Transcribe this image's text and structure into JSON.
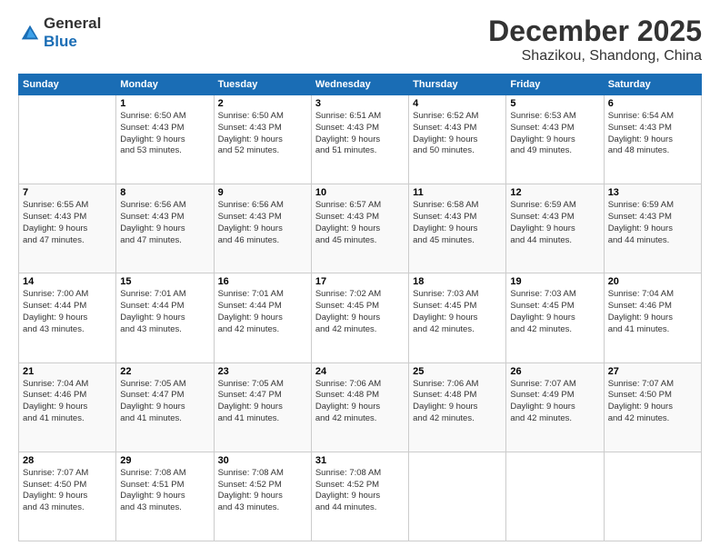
{
  "logo": {
    "line1": "General",
    "line2": "Blue"
  },
  "header": {
    "month": "December 2025",
    "location": "Shazikou, Shandong, China"
  },
  "days": [
    "Sunday",
    "Monday",
    "Tuesday",
    "Wednesday",
    "Thursday",
    "Friday",
    "Saturday"
  ],
  "weeks": [
    [
      {
        "day": "",
        "sunrise": "",
        "sunset": "",
        "daylight": ""
      },
      {
        "day": "1",
        "sunrise": "Sunrise: 6:50 AM",
        "sunset": "Sunset: 4:43 PM",
        "daylight": "Daylight: 9 hours and 53 minutes."
      },
      {
        "day": "2",
        "sunrise": "Sunrise: 6:50 AM",
        "sunset": "Sunset: 4:43 PM",
        "daylight": "Daylight: 9 hours and 52 minutes."
      },
      {
        "day": "3",
        "sunrise": "Sunrise: 6:51 AM",
        "sunset": "Sunset: 4:43 PM",
        "daylight": "Daylight: 9 hours and 51 minutes."
      },
      {
        "day": "4",
        "sunrise": "Sunrise: 6:52 AM",
        "sunset": "Sunset: 4:43 PM",
        "daylight": "Daylight: 9 hours and 50 minutes."
      },
      {
        "day": "5",
        "sunrise": "Sunrise: 6:53 AM",
        "sunset": "Sunset: 4:43 PM",
        "daylight": "Daylight: 9 hours and 49 minutes."
      },
      {
        "day": "6",
        "sunrise": "Sunrise: 6:54 AM",
        "sunset": "Sunset: 4:43 PM",
        "daylight": "Daylight: 9 hours and 48 minutes."
      }
    ],
    [
      {
        "day": "7",
        "sunrise": "Sunrise: 6:55 AM",
        "sunset": "Sunset: 4:43 PM",
        "daylight": "Daylight: 9 hours and 47 minutes."
      },
      {
        "day": "8",
        "sunrise": "Sunrise: 6:56 AM",
        "sunset": "Sunset: 4:43 PM",
        "daylight": "Daylight: 9 hours and 47 minutes."
      },
      {
        "day": "9",
        "sunrise": "Sunrise: 6:56 AM",
        "sunset": "Sunset: 4:43 PM",
        "daylight": "Daylight: 9 hours and 46 minutes."
      },
      {
        "day": "10",
        "sunrise": "Sunrise: 6:57 AM",
        "sunset": "Sunset: 4:43 PM",
        "daylight": "Daylight: 9 hours and 45 minutes."
      },
      {
        "day": "11",
        "sunrise": "Sunrise: 6:58 AM",
        "sunset": "Sunset: 4:43 PM",
        "daylight": "Daylight: 9 hours and 45 minutes."
      },
      {
        "day": "12",
        "sunrise": "Sunrise: 6:59 AM",
        "sunset": "Sunset: 4:43 PM",
        "daylight": "Daylight: 9 hours and 44 minutes."
      },
      {
        "day": "13",
        "sunrise": "Sunrise: 6:59 AM",
        "sunset": "Sunset: 4:43 PM",
        "daylight": "Daylight: 9 hours and 44 minutes."
      }
    ],
    [
      {
        "day": "14",
        "sunrise": "Sunrise: 7:00 AM",
        "sunset": "Sunset: 4:44 PM",
        "daylight": "Daylight: 9 hours and 43 minutes."
      },
      {
        "day": "15",
        "sunrise": "Sunrise: 7:01 AM",
        "sunset": "Sunset: 4:44 PM",
        "daylight": "Daylight: 9 hours and 43 minutes."
      },
      {
        "day": "16",
        "sunrise": "Sunrise: 7:01 AM",
        "sunset": "Sunset: 4:44 PM",
        "daylight": "Daylight: 9 hours and 42 minutes."
      },
      {
        "day": "17",
        "sunrise": "Sunrise: 7:02 AM",
        "sunset": "Sunset: 4:45 PM",
        "daylight": "Daylight: 9 hours and 42 minutes."
      },
      {
        "day": "18",
        "sunrise": "Sunrise: 7:03 AM",
        "sunset": "Sunset: 4:45 PM",
        "daylight": "Daylight: 9 hours and 42 minutes."
      },
      {
        "day": "19",
        "sunrise": "Sunrise: 7:03 AM",
        "sunset": "Sunset: 4:45 PM",
        "daylight": "Daylight: 9 hours and 42 minutes."
      },
      {
        "day": "20",
        "sunrise": "Sunrise: 7:04 AM",
        "sunset": "Sunset: 4:46 PM",
        "daylight": "Daylight: 9 hours and 41 minutes."
      }
    ],
    [
      {
        "day": "21",
        "sunrise": "Sunrise: 7:04 AM",
        "sunset": "Sunset: 4:46 PM",
        "daylight": "Daylight: 9 hours and 41 minutes."
      },
      {
        "day": "22",
        "sunrise": "Sunrise: 7:05 AM",
        "sunset": "Sunset: 4:47 PM",
        "daylight": "Daylight: 9 hours and 41 minutes."
      },
      {
        "day": "23",
        "sunrise": "Sunrise: 7:05 AM",
        "sunset": "Sunset: 4:47 PM",
        "daylight": "Daylight: 9 hours and 41 minutes."
      },
      {
        "day": "24",
        "sunrise": "Sunrise: 7:06 AM",
        "sunset": "Sunset: 4:48 PM",
        "daylight": "Daylight: 9 hours and 42 minutes."
      },
      {
        "day": "25",
        "sunrise": "Sunrise: 7:06 AM",
        "sunset": "Sunset: 4:48 PM",
        "daylight": "Daylight: 9 hours and 42 minutes."
      },
      {
        "day": "26",
        "sunrise": "Sunrise: 7:07 AM",
        "sunset": "Sunset: 4:49 PM",
        "daylight": "Daylight: 9 hours and 42 minutes."
      },
      {
        "day": "27",
        "sunrise": "Sunrise: 7:07 AM",
        "sunset": "Sunset: 4:50 PM",
        "daylight": "Daylight: 9 hours and 42 minutes."
      }
    ],
    [
      {
        "day": "28",
        "sunrise": "Sunrise: 7:07 AM",
        "sunset": "Sunset: 4:50 PM",
        "daylight": "Daylight: 9 hours and 43 minutes."
      },
      {
        "day": "29",
        "sunrise": "Sunrise: 7:08 AM",
        "sunset": "Sunset: 4:51 PM",
        "daylight": "Daylight: 9 hours and 43 minutes."
      },
      {
        "day": "30",
        "sunrise": "Sunrise: 7:08 AM",
        "sunset": "Sunset: 4:52 PM",
        "daylight": "Daylight: 9 hours and 43 minutes."
      },
      {
        "day": "31",
        "sunrise": "Sunrise: 7:08 AM",
        "sunset": "Sunset: 4:52 PM",
        "daylight": "Daylight: 9 hours and 44 minutes."
      },
      {
        "day": "",
        "sunrise": "",
        "sunset": "",
        "daylight": ""
      },
      {
        "day": "",
        "sunrise": "",
        "sunset": "",
        "daylight": ""
      },
      {
        "day": "",
        "sunrise": "",
        "sunset": "",
        "daylight": ""
      }
    ]
  ]
}
